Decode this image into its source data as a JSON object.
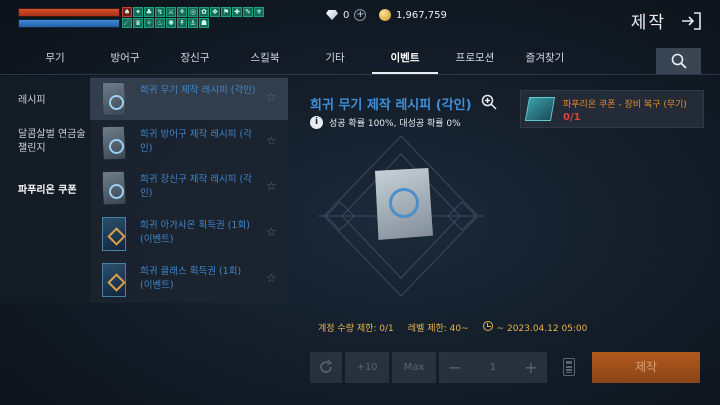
{
  "status": {
    "buff_icons": [
      "♠",
      "✦",
      "♣",
      "↯",
      "⚔",
      "⚘",
      "◎",
      "✿",
      "❖",
      "⚑",
      "✚",
      "✎",
      "⚜",
      "☄",
      "♛",
      "✧",
      "♨",
      "✺",
      "↟",
      "⚓",
      "☗"
    ],
    "diamonds": "0",
    "gold": "1,967,759"
  },
  "header": {
    "title": "제작"
  },
  "tabs": [
    {
      "label": "무기"
    },
    {
      "label": "방어구"
    },
    {
      "label": "장신구"
    },
    {
      "label": "스킬북"
    },
    {
      "label": "기타"
    },
    {
      "label": "이벤트",
      "active": true
    },
    {
      "label": "프로모션"
    },
    {
      "label": "즐겨찾기"
    }
  ],
  "categories": [
    {
      "label": "레시피"
    },
    {
      "label": "달콤살벌 연금술\n챌린지"
    },
    {
      "label": "파푸리온 쿠폰",
      "active": true
    }
  ],
  "items": [
    {
      "label": "희귀 무기 제작 레시피 (각인)"
    },
    {
      "label": "희귀 방어구 제작 레시피 (각인)"
    },
    {
      "label": "희귀 장신구 제작 레시피 (각인)"
    },
    {
      "label": "희귀 아가사온 획득권 (1회)\n(이벤트)"
    },
    {
      "label": "희귀 클래스 획득권 (1회)\n(이벤트)"
    }
  ],
  "detail": {
    "title": "희귀 무기 제작 레시피 (각인)",
    "info": "성공 확률 100%, 대성공 확률 0%"
  },
  "material": {
    "name": "파푸리온 쿠폰 - 장비 복구 (무기)",
    "count": "0/1"
  },
  "limits": {
    "account": "계정 수량 제한: 0/1",
    "level": "레벨 제한: 40~",
    "period": "~ 2023.04.12 05:00"
  },
  "controls": {
    "plus10": "+10",
    "max": "Max",
    "minus": "−",
    "quantity": "1",
    "plus": "+",
    "craft": "제작"
  },
  "colors": {
    "accent_blue": "#3f8fd6",
    "warning_orange": "#e58a2e",
    "error_red": "#e04038",
    "limit_gold": "#e8b24a"
  }
}
